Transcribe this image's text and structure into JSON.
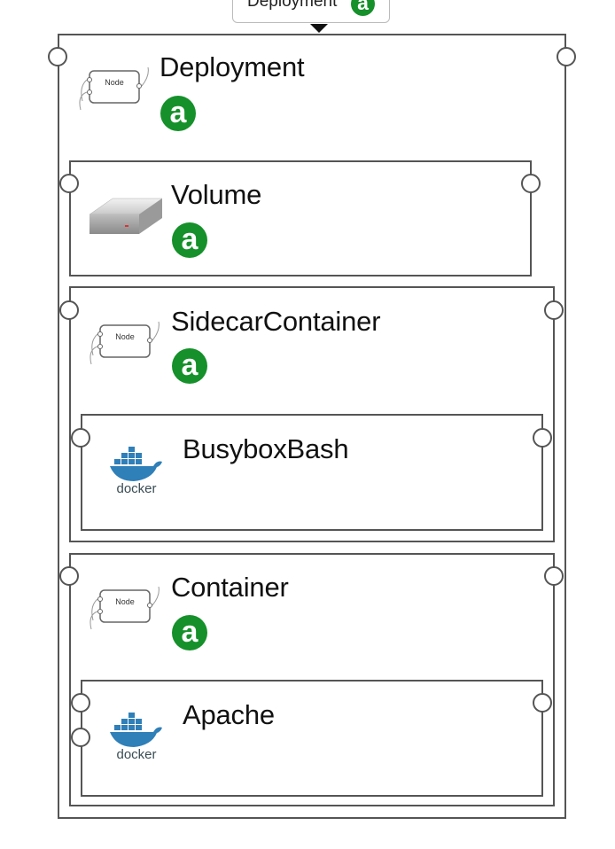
{
  "tab": {
    "label": "Deployment",
    "badge": "a"
  },
  "deployment": {
    "title": "Deployment",
    "badge": "a",
    "icon": "node-icon",
    "icon_label": "Node",
    "volume": {
      "title": "Volume",
      "badge": "a",
      "icon": "hard-drive-icon"
    },
    "sidecar": {
      "title": "SidecarContainer",
      "badge": "a",
      "icon": "node-icon",
      "icon_label": "Node",
      "image": {
        "title": "BusyboxBash",
        "icon": "docker-icon",
        "icon_label": "docker"
      }
    },
    "container": {
      "title": "Container",
      "badge": "a",
      "icon": "node-icon",
      "icon_label": "Node",
      "image": {
        "title": "Apache",
        "icon": "docker-icon",
        "icon_label": "docker"
      }
    }
  },
  "colors": {
    "badge": "#15902a",
    "border": "#555555",
    "docker": "#2f7fb8"
  }
}
